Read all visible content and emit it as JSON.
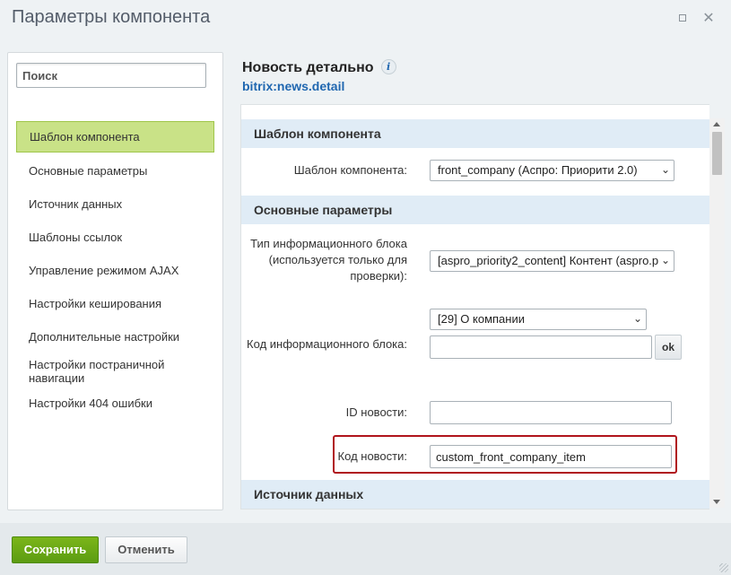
{
  "window": {
    "title": "Параметры компонента"
  },
  "sidebar": {
    "search_placeholder": "Поиск",
    "items": [
      {
        "label": "Шаблон компонента",
        "active": true
      },
      {
        "label": "Основные параметры"
      },
      {
        "label": "Источник данных"
      },
      {
        "label": "Шаблоны ссылок"
      },
      {
        "label": "Управление режимом AJAX"
      },
      {
        "label": "Настройки кеширования"
      },
      {
        "label": "Дополнительные настройки"
      },
      {
        "label": "Настройки постраничной навигации"
      },
      {
        "label": "Настройки 404 ошибки"
      }
    ]
  },
  "main": {
    "title": "Новость детально",
    "info_icon": "i",
    "code": "bitrix:news.detail",
    "sections": [
      {
        "title": "Шаблон компонента"
      },
      {
        "title": "Основные параметры"
      },
      {
        "title": "Источник данных"
      }
    ],
    "fields": {
      "template": {
        "label": "Шаблон компонента:",
        "value": "front_company (Аспро: Приорити 2.0)"
      },
      "iblock_type": {
        "label": "Тип информационного блока (используется только для проверки):",
        "value": "[aspro_priority2_content] Контент (aspro.p"
      },
      "iblock_code": {
        "label": "Код информационного блока:",
        "select_value": "[29] О компании",
        "input_value": "",
        "ok_label": "ok"
      },
      "news_id": {
        "label": "ID новости:",
        "value": ""
      },
      "news_code": {
        "label": "Код новости:",
        "value": "custom_front_company_item"
      }
    }
  },
  "footer": {
    "save_label": "Сохранить",
    "cancel_label": "Отменить"
  },
  "colors": {
    "accent_green": "#c9e287",
    "save_green": "#6aa816",
    "section_bg": "#e0ecf6",
    "link_blue": "#2067b0",
    "highlight_red": "#b0141c"
  }
}
